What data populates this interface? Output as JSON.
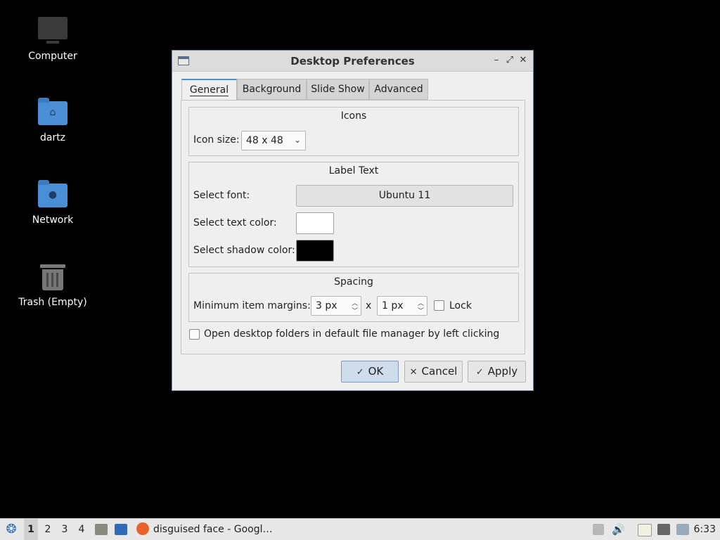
{
  "desktop": {
    "icons": [
      {
        "label": "Computer",
        "icon": "computer-icon"
      },
      {
        "label": "dartz",
        "icon": "home-folder-icon"
      },
      {
        "label": "Network",
        "icon": "network-folder-icon"
      },
      {
        "label": "Trash (Empty)",
        "icon": "trash-icon"
      }
    ]
  },
  "dialog": {
    "title": "Desktop Preferences",
    "tabs": [
      "General",
      "Background",
      "Slide Show",
      "Advanced"
    ],
    "active_tab": "General",
    "icons_group": {
      "title": "Icons",
      "icon_size_label": "Icon size:",
      "icon_size_value": "48 x 48"
    },
    "label_group": {
      "title": "Label Text",
      "font_label": "Select font:",
      "font_value": "Ubuntu 11",
      "text_color_label": "Select text color:",
      "text_color": "#ffffff",
      "shadow_color_label": "Select shadow color:",
      "shadow_color": "#000000"
    },
    "spacing_group": {
      "title": "Spacing",
      "margins_label": "Minimum item margins:",
      "margin_x": "3 px",
      "separator": "x",
      "margin_y": "1 px",
      "lock_label": "Lock",
      "lock_checked": false
    },
    "open_folders_label": "Open desktop folders in default file manager by left clicking",
    "open_folders_checked": false,
    "buttons": {
      "ok": "OK",
      "cancel": "Cancel",
      "apply": "Apply"
    }
  },
  "taskbar": {
    "workspaces": [
      "1",
      "2",
      "3",
      "4"
    ],
    "active_workspace": "1",
    "window_title": "disguised face - Googl…",
    "clock": "6:33"
  },
  "colors": {
    "accent": "#4a90d9",
    "desktop_bg": "#000000",
    "folder": "#4a8fd6"
  }
}
